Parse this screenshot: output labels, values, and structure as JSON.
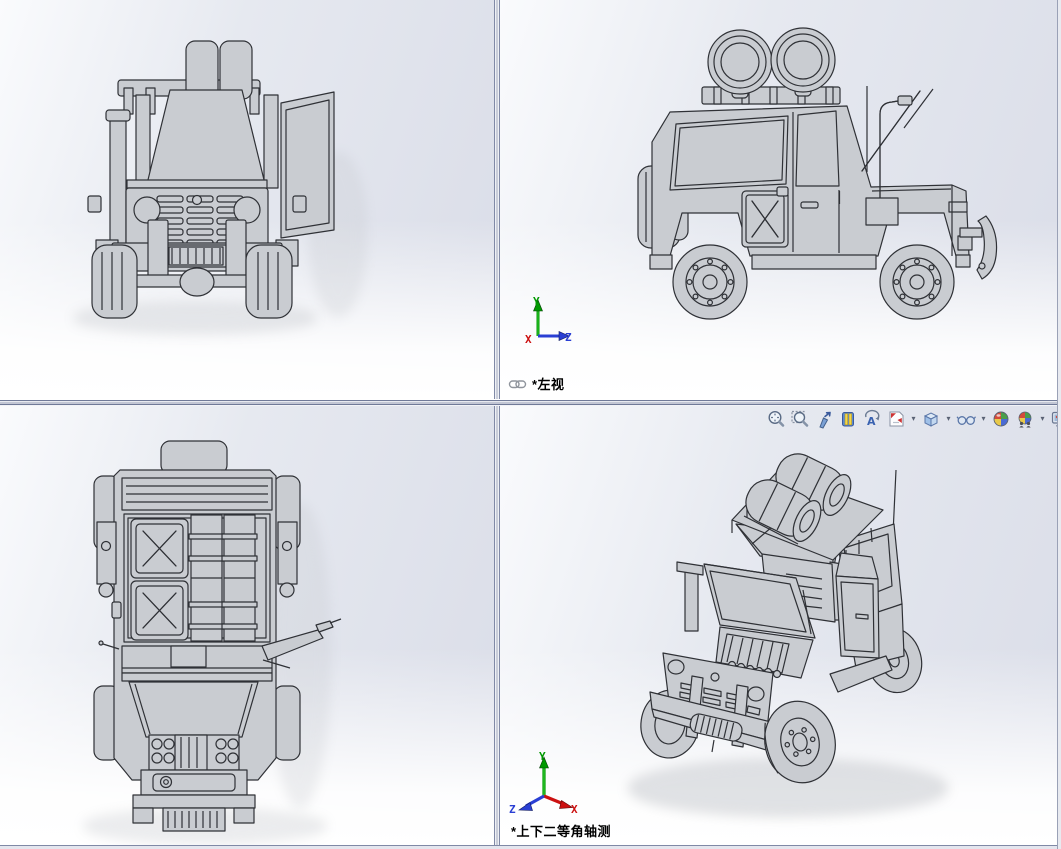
{
  "panes": {
    "top_right": {
      "view_label": "*左视"
    },
    "bottom_right": {
      "view_label": "*上下二等角轴测"
    }
  },
  "heads_up_toolbar": {
    "dropdown_glyph": "▾",
    "buttons": [
      {
        "name": "zoom-to-fit"
      },
      {
        "name": "zoom-to-area"
      },
      {
        "name": "previous-view"
      },
      {
        "name": "section-view"
      },
      {
        "name": "3d-drawing-view"
      },
      {
        "name": "view-orientation",
        "dropdown": true
      },
      {
        "name": "display-style",
        "dropdown": true
      },
      {
        "name": "hide-show-items",
        "dropdown": true
      },
      {
        "name": "edit-appearance"
      },
      {
        "name": "apply-scene",
        "dropdown": true
      },
      {
        "name": "view-settings"
      }
    ]
  },
  "triads": {
    "side_view": {
      "x": "X",
      "y": "Y",
      "z": "Z"
    },
    "isometric_view": {
      "x": "X",
      "y": "Y",
      "z": "Z"
    }
  },
  "colors": {
    "axis_x": "#cc1111",
    "axis_y": "#009900",
    "axis_z": "#2a3fd4",
    "viewport_gradient_top": "#dde0ea",
    "viewport_gradient_bottom": "#ffffff",
    "model_fill": "#c9ccd1",
    "model_outline": "#2f3136",
    "iso_panel_tint": "#a89bad",
    "splitter": "#707a98"
  }
}
